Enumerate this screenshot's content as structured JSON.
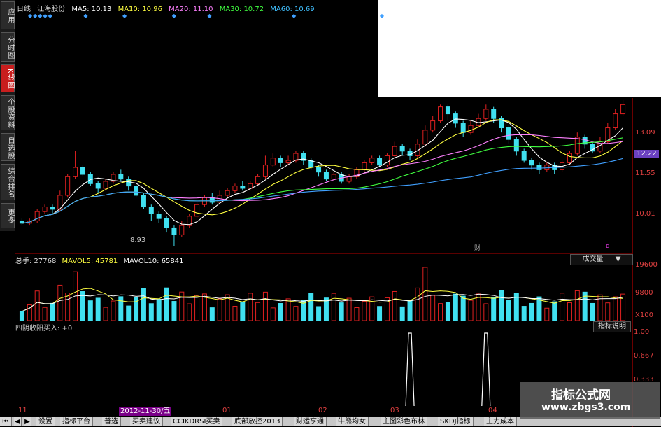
{
  "sidebar": {
    "tabs": [
      {
        "label": "应用",
        "active": false
      },
      {
        "label": "分时图",
        "active": false
      },
      {
        "label": "K线图",
        "active": true
      },
      {
        "label": "个股资料",
        "active": false
      },
      {
        "label": "自选股",
        "active": false
      },
      {
        "label": "综合排名",
        "active": false
      },
      {
        "label": "更多",
        "active": false
      }
    ]
  },
  "info_bar": {
    "period": "日线",
    "stock_name": "江海股份",
    "ma5": "MA5: 10.13",
    "ma10": "MA10: 10.96",
    "ma20": "MA20: 11.10",
    "ma30": "MA30: 10.72",
    "ma60": "MA60: 10.69"
  },
  "colors": {
    "up": "#e02020",
    "down": "#40e0f0",
    "ma5": "#ffffff",
    "ma10": "#ffff40",
    "ma20": "#ff80ff",
    "ma30": "#40ff40",
    "ma60": "#40a0ff",
    "axis": "#e04040"
  },
  "price_axis": {
    "labels": [
      "13.09",
      "11.55",
      "10.01"
    ],
    "current": "12.22"
  },
  "low_marker": "8.93",
  "volume_panel": {
    "total": "总手: 27768",
    "mavol5": "MAVOL5: 45781",
    "mavol10": "MAVOL10: 65841",
    "dropdown": "成交量",
    "axis_labels": [
      "19600",
      "9800",
      "X100"
    ]
  },
  "indicator_panel": {
    "title": "四阴收阳买入: +0",
    "button": "指标说明",
    "axis_labels": [
      "1.00",
      "0.667",
      "0.333"
    ]
  },
  "date_axis": {
    "labels": [
      "11",
      "2012-11-30/五",
      "01",
      "02",
      "03",
      "04"
    ]
  },
  "bottom_tabs": [
    "设置",
    "指标平台",
    "普选",
    "买卖建议",
    "CCIKDRSI买卖",
    "底部放控2013",
    "财运亨通",
    "牛熊均女",
    "主图彩色布林",
    "SKDJ指标",
    "主力成本"
  ],
  "watermark": {
    "line1": "指标公式网",
    "line2": "www.zbgs3.com"
  },
  "chart_data": {
    "type": "candlestick",
    "candles": [
      [
        10.0,
        9.9,
        10.1,
        9.8
      ],
      [
        9.9,
        10.0,
        10.1,
        9.8
      ],
      [
        10.0,
        10.4,
        10.5,
        9.9
      ],
      [
        10.4,
        10.6,
        10.7,
        10.3
      ],
      [
        10.6,
        10.5,
        10.7,
        10.3
      ],
      [
        10.5,
        11.1,
        11.3,
        10.4
      ],
      [
        11.1,
        11.9,
        12.0,
        11.0
      ],
      [
        11.9,
        12.3,
        13.0,
        11.8
      ],
      [
        12.3,
        12.0,
        12.4,
        11.9
      ],
      [
        12.0,
        11.6,
        12.1,
        11.5
      ],
      [
        11.6,
        11.4,
        11.7,
        11.2
      ],
      [
        11.4,
        11.7,
        11.8,
        11.3
      ],
      [
        11.7,
        12.0,
        12.1,
        11.6
      ],
      [
        12.0,
        11.8,
        12.2,
        11.7
      ],
      [
        11.8,
        11.5,
        11.9,
        11.3
      ],
      [
        11.5,
        11.1,
        11.6,
        11.0
      ],
      [
        11.1,
        10.6,
        11.2,
        10.5
      ],
      [
        10.6,
        10.3,
        10.7,
        10.0
      ],
      [
        10.3,
        10.1,
        10.4,
        9.9
      ],
      [
        10.1,
        9.7,
        10.2,
        9.5
      ],
      [
        9.7,
        9.4,
        9.8,
        8.93
      ],
      [
        9.4,
        9.8,
        10.0,
        9.3
      ],
      [
        9.8,
        10.2,
        10.3,
        9.7
      ],
      [
        10.2,
        10.7,
        10.8,
        10.1
      ],
      [
        10.7,
        11.0,
        11.1,
        10.6
      ],
      [
        11.0,
        10.8,
        11.2,
        10.7
      ],
      [
        10.8,
        11.1,
        11.3,
        10.7
      ],
      [
        11.1,
        11.3,
        11.4,
        11.0
      ],
      [
        11.3,
        11.5,
        11.6,
        11.2
      ],
      [
        11.5,
        11.4,
        11.7,
        11.3
      ],
      [
        11.4,
        11.6,
        11.7,
        11.3
      ],
      [
        11.6,
        11.9,
        12.0,
        11.5
      ],
      [
        11.9,
        12.4,
        12.8,
        11.8
      ],
      [
        12.4,
        12.7,
        12.9,
        12.3
      ],
      [
        12.7,
        12.5,
        12.8,
        12.3
      ],
      [
        12.5,
        12.6,
        12.8,
        12.4
      ],
      [
        12.6,
        12.9,
        13.0,
        12.5
      ],
      [
        12.9,
        12.6,
        13.0,
        12.4
      ],
      [
        12.6,
        12.3,
        12.7,
        12.2
      ],
      [
        12.3,
        12.1,
        12.4,
        11.9
      ],
      [
        12.1,
        11.8,
        12.2,
        11.7
      ],
      [
        11.8,
        12.0,
        12.1,
        11.7
      ],
      [
        12.0,
        11.7,
        12.1,
        11.6
      ],
      [
        11.7,
        11.9,
        12.0,
        11.6
      ],
      [
        11.9,
        12.2,
        12.3,
        11.8
      ],
      [
        12.2,
        12.5,
        12.6,
        12.1
      ],
      [
        12.5,
        12.7,
        12.8,
        12.4
      ],
      [
        12.7,
        12.4,
        12.8,
        12.3
      ],
      [
        12.4,
        12.8,
        12.9,
        12.3
      ],
      [
        12.8,
        13.2,
        13.4,
        12.7
      ],
      [
        13.2,
        13.0,
        13.3,
        12.8
      ],
      [
        13.0,
        12.8,
        13.1,
        12.6
      ],
      [
        12.8,
        13.3,
        13.5,
        12.7
      ],
      [
        13.3,
        13.9,
        14.1,
        13.2
      ],
      [
        13.9,
        14.3,
        14.5,
        13.8
      ],
      [
        14.3,
        14.9,
        15.0,
        14.2
      ],
      [
        14.9,
        14.6,
        15.0,
        14.3
      ],
      [
        14.6,
        14.2,
        14.7,
        14.0
      ],
      [
        14.2,
        13.8,
        14.3,
        13.6
      ],
      [
        13.8,
        14.1,
        14.3,
        13.7
      ],
      [
        14.1,
        14.4,
        14.6,
        14.0
      ],
      [
        14.4,
        14.8,
        15.0,
        14.3
      ],
      [
        14.8,
        14.4,
        14.9,
        14.2
      ],
      [
        14.4,
        14.0,
        14.5,
        13.8
      ],
      [
        14.0,
        13.5,
        14.1,
        13.3
      ],
      [
        13.5,
        13.0,
        13.6,
        12.8
      ],
      [
        13.0,
        12.6,
        13.1,
        12.5
      ],
      [
        12.6,
        12.4,
        12.7,
        12.2
      ],
      [
        12.4,
        12.2,
        12.5,
        12.0
      ],
      [
        12.2,
        12.4,
        12.5,
        12.1
      ],
      [
        12.4,
        12.2,
        12.5,
        12.0
      ],
      [
        12.2,
        12.5,
        12.6,
        12.1
      ],
      [
        12.5,
        12.9,
        13.0,
        12.4
      ],
      [
        12.9,
        13.6,
        13.8,
        12.8
      ],
      [
        13.6,
        13.3,
        13.7,
        13.1
      ],
      [
        13.3,
        13.0,
        13.4,
        12.9
      ],
      [
        13.0,
        13.4,
        13.6,
        12.9
      ],
      [
        13.4,
        14.0,
        14.2,
        13.3
      ],
      [
        14.0,
        14.6,
        14.8,
        13.9
      ],
      [
        14.6,
        15.0,
        15.2,
        14.5
      ]
    ],
    "volume_max": 19600,
    "indicator_signals": [
      51,
      61
    ]
  }
}
